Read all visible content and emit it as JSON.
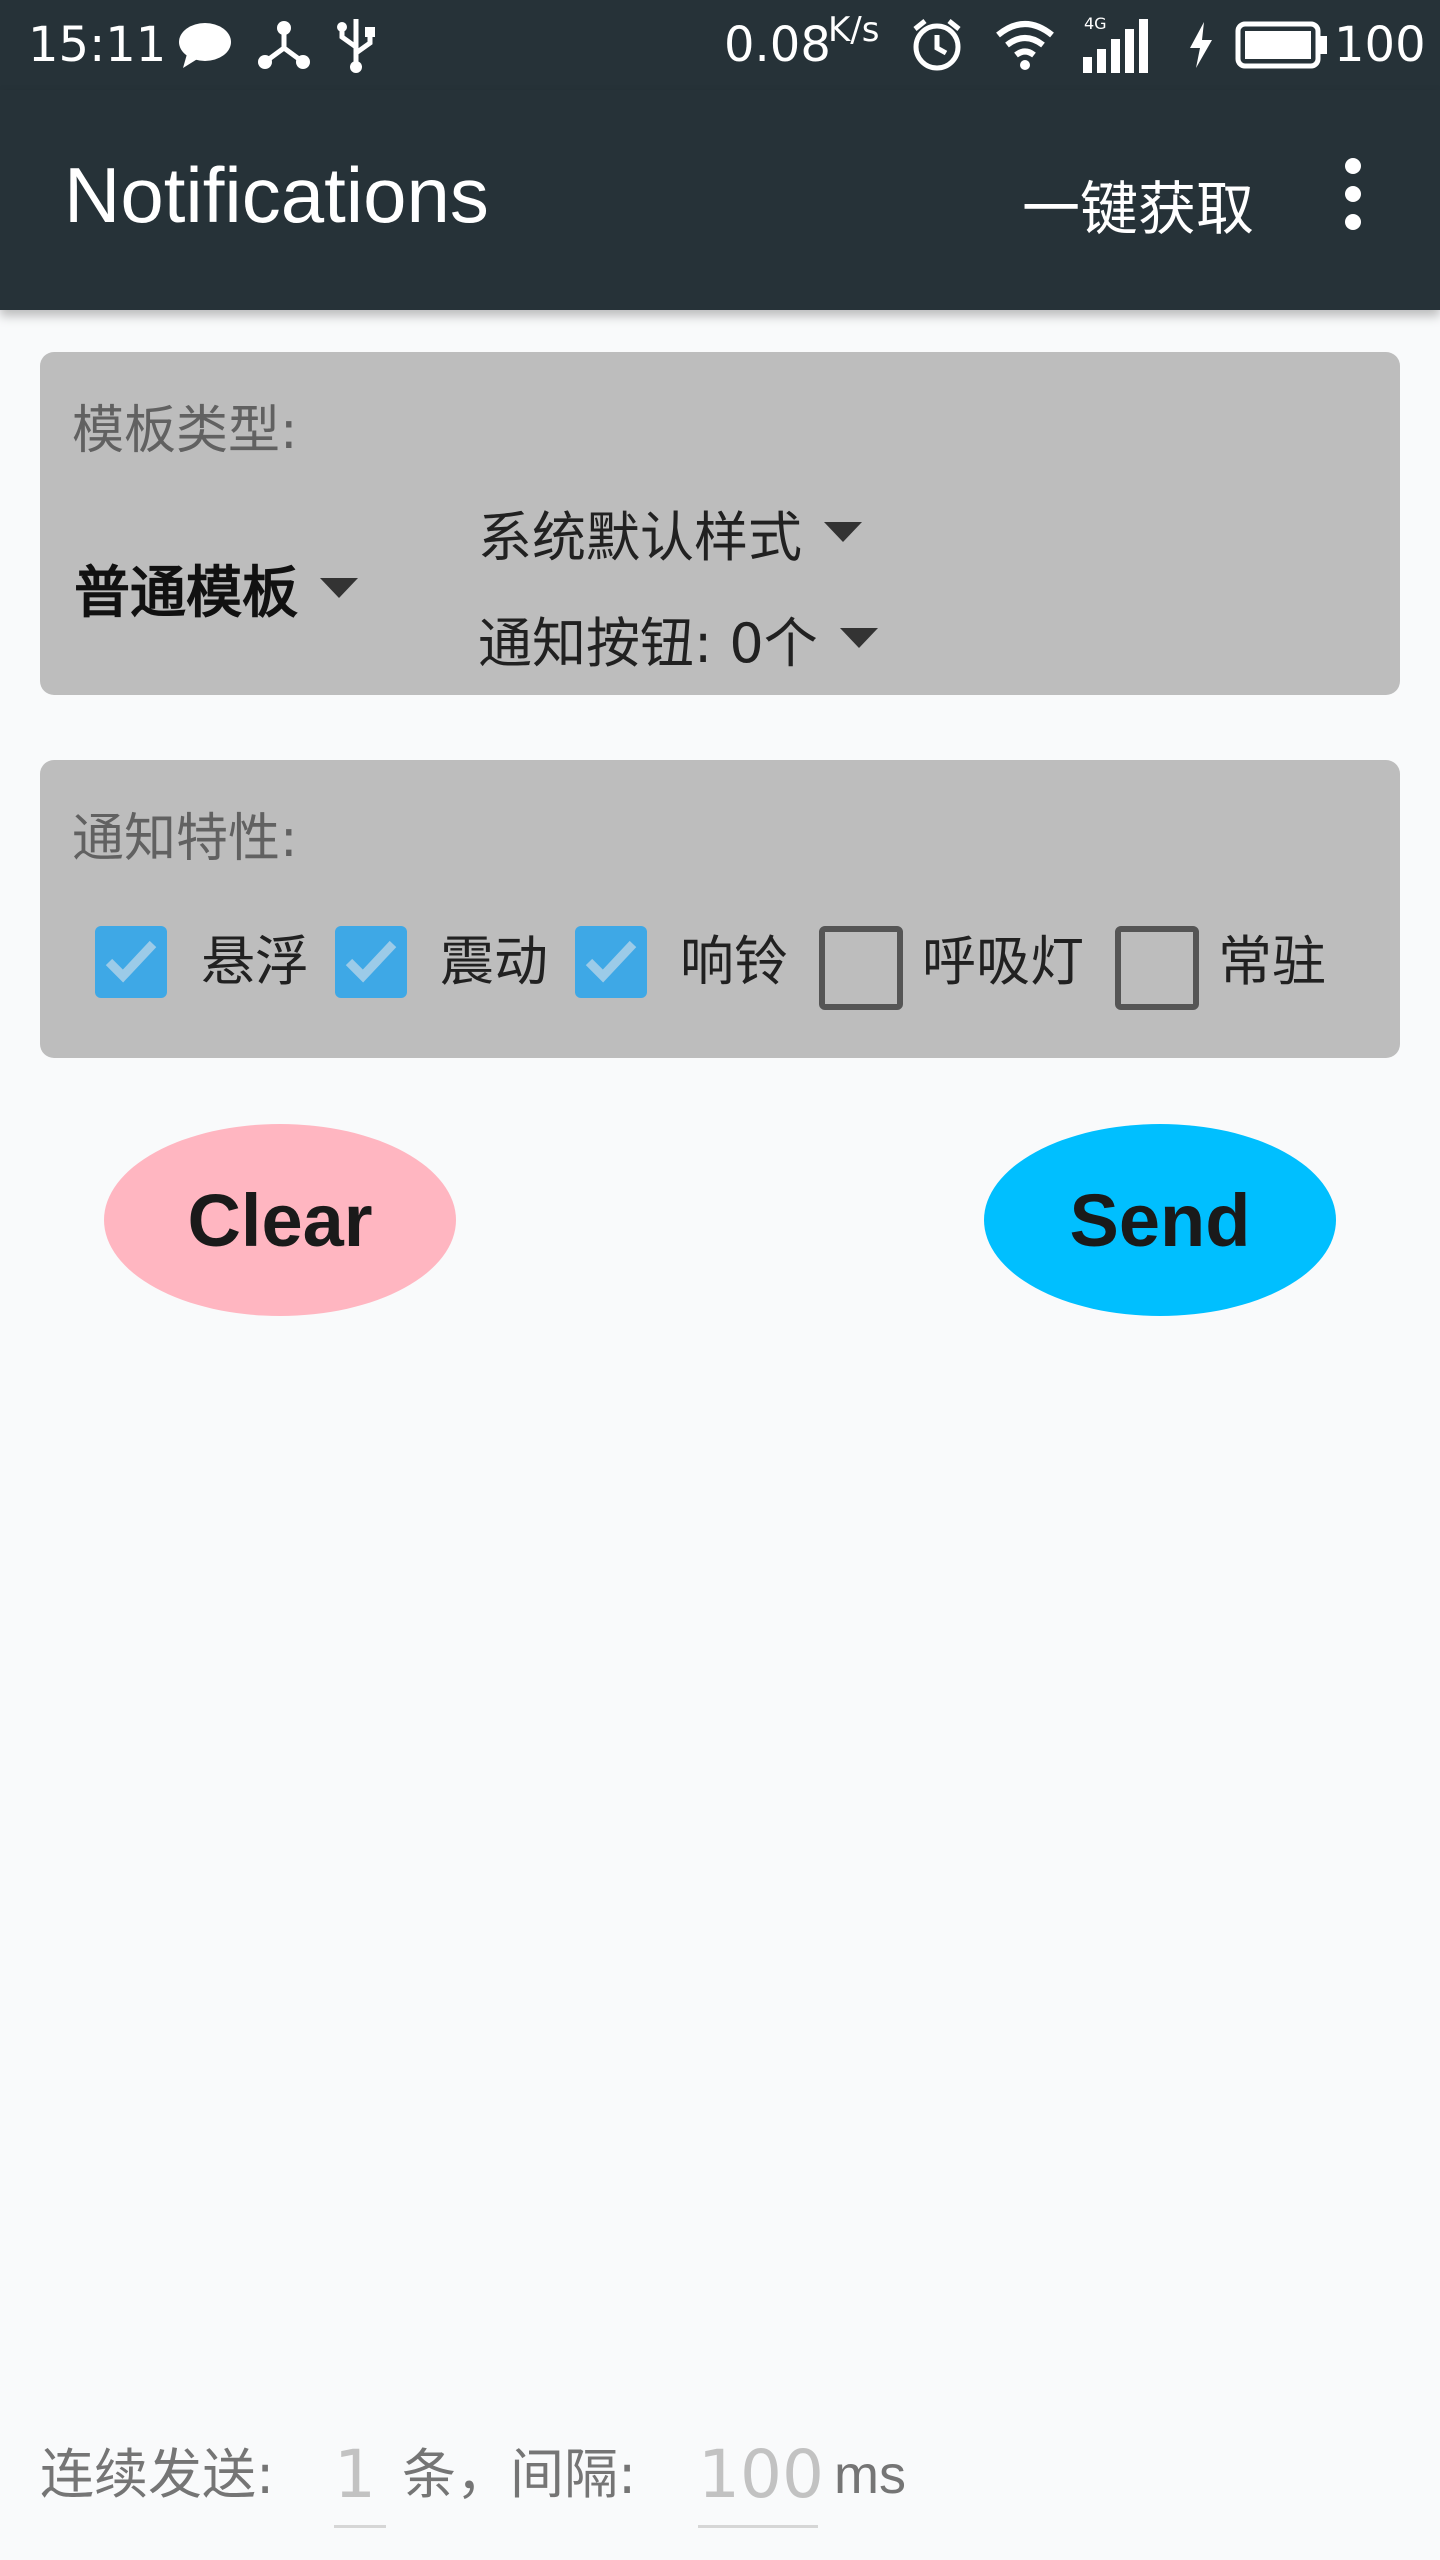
{
  "status_bar": {
    "time": "15:11",
    "net_speed": "0.08",
    "net_speed_unit": "K/s",
    "network_type": "4G",
    "battery": "100",
    "icons": [
      "chat-bubble-icon",
      "share-icon",
      "usb-icon",
      "alarm-icon",
      "wifi-icon",
      "signal-icon",
      "charging-icon",
      "battery-icon"
    ]
  },
  "appbar": {
    "title": "Notifications",
    "action_label": "一键获取",
    "overflow_icon": "more-vert-icon"
  },
  "template_card": {
    "label": "模板类型:",
    "template_select": "普通模板",
    "style_select": "系统默认样式",
    "button_select": "通知按钮: 0个"
  },
  "features_card": {
    "label": "通知特性:",
    "options": [
      {
        "label": "悬浮",
        "checked": true
      },
      {
        "label": "震动",
        "checked": true
      },
      {
        "label": "响铃",
        "checked": true
      },
      {
        "label": "呼吸灯",
        "checked": false
      },
      {
        "label": "常驻",
        "checked": false
      }
    ]
  },
  "actions": {
    "clear_label": "Clear",
    "send_label": "Send",
    "clear_color": "#ffb6c1",
    "send_color": "#00bfff"
  },
  "footer": {
    "prefix": "连续发送:",
    "count_value": "1",
    "count_unit": "条，间隔:",
    "interval_value": "100",
    "interval_unit": "ms"
  },
  "colors": {
    "appbar": "#263238",
    "card": "#bdbdbd",
    "checkbox_checked": "#3ea8e6",
    "background": "#f9fafb"
  }
}
